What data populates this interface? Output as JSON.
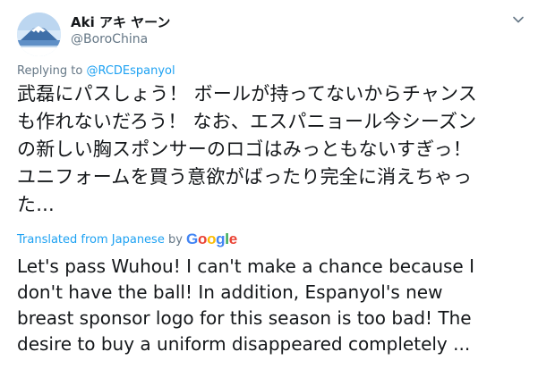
{
  "tweet": {
    "display_name": "Aki アキ ヤーン",
    "handle": "@BoroChina",
    "avatar_icon": "mount-fuji-avatar-icon",
    "reply_prefix": "Replying to ",
    "reply_target": "@RCDEspanyol",
    "text_lines": [
      "武磊にパスしょう！ ボールが持ってないからチャンス",
      "も作れないだろう！ なお、エスパニョール今シーズン",
      "の新しい胸スポンサーのロゴはみっともないすぎっ！",
      "ユニフォームを買う意欲がばったり完全に消えちゃっ",
      "た..."
    ],
    "translated_label": "Translated from Japanese",
    "translated_by": " by ",
    "google_letters": [
      {
        "ch": "G",
        "color": "#4285F4"
      },
      {
        "ch": "o",
        "color": "#EA4335"
      },
      {
        "ch": "o",
        "color": "#FBBC05"
      },
      {
        "ch": "g",
        "color": "#4285F4"
      },
      {
        "ch": "l",
        "color": "#34A853"
      },
      {
        "ch": "e",
        "color": "#EA4335"
      }
    ],
    "translation_lines": [
      "Let's pass Wuhou! I can't make a chance because I",
      "don't have the ball! In addition, Espanyol's new",
      "breast sponsor logo for this season is too bad! The",
      "desire to buy a uniform disappeared completely ..."
    ]
  },
  "colors": {
    "link": "#1da1f2",
    "secondary_text": "#657786",
    "primary_text": "#14171a"
  }
}
